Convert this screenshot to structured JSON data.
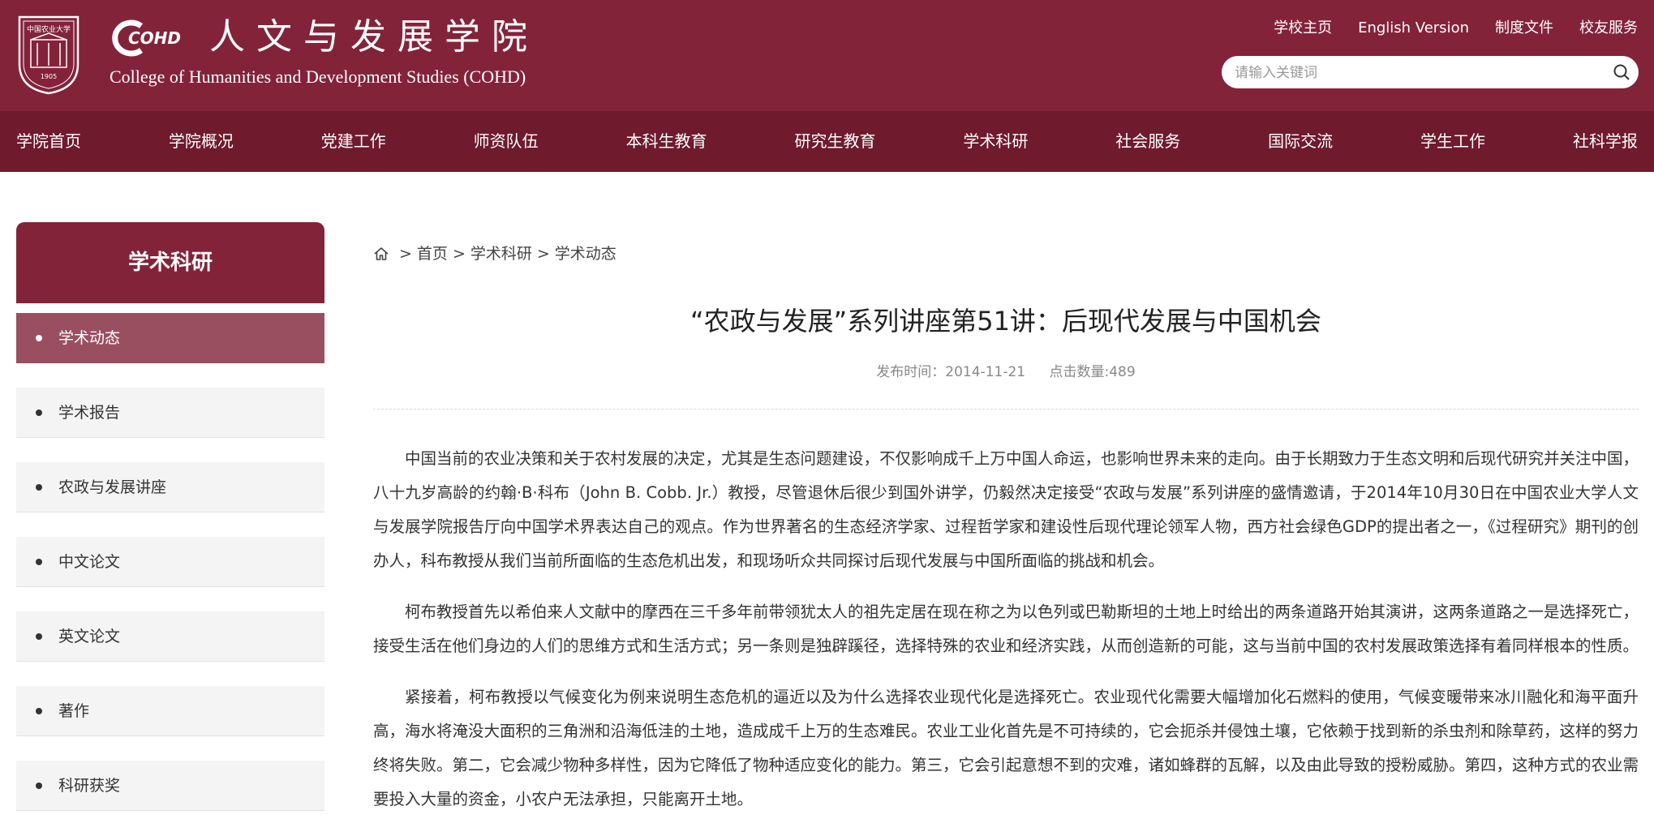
{
  "header": {
    "logo_title_cn": "人文与发展学院",
    "logo_title_en": "College of Humanities and Development Studies (COHD)",
    "logo_mark_text": "COHD",
    "seal_text": "中国农业大学",
    "seal_year": "1905",
    "top_links": [
      "学校主页",
      "English Version",
      "制度文件",
      "校友服务"
    ],
    "search_placeholder": "请输入关键词",
    "brand_color": "#83233a",
    "nav_color": "#6f1a2d"
  },
  "nav": {
    "items": [
      "学院首页",
      "学院概况",
      "党建工作",
      "师资队伍",
      "本科生教育",
      "研究生教育",
      "学术科研",
      "社会服务",
      "国际交流",
      "学生工作",
      "社科学报"
    ]
  },
  "sidebar": {
    "title": "学术科研",
    "items": [
      {
        "label": "学术动态",
        "active": true
      },
      {
        "label": "学术报告",
        "active": false
      },
      {
        "label": "农政与发展讲座",
        "active": false
      },
      {
        "label": "中文论文",
        "active": false
      },
      {
        "label": "英文论文",
        "active": false
      },
      {
        "label": "著作",
        "active": false
      },
      {
        "label": "科研获奖",
        "active": false
      }
    ]
  },
  "breadcrumb": {
    "icon": "home-icon",
    "items": [
      "首页",
      "学术科研",
      "学术动态"
    ],
    "separator": ">"
  },
  "article": {
    "title": "“农政与发展”系列讲座第51讲：后现代发展与中国机会",
    "publish_label": "发布时间：2014-11-21",
    "views_label": "点击数量:489",
    "paragraphs": [
      "中国当前的农业决策和关于农村发展的决定，尤其是生态问题建设，不仅影响成千上万中国人命运，也影响世界未来的走向。由于长期致力于生态文明和后现代研究并关注中国，八十九岁高龄的约翰·B·科布（John B. Cobb. Jr.）教授，尽管退休后很少到国外讲学，仍毅然决定接受“农政与发展”系列讲座的盛情邀请，于2014年10月30日在中国农业大学人文与发展学院报告厅向中国学术界表达自己的观点。作为世界著名的生态经济学家、过程哲学家和建设性后现代理论领军人物，西方社会绿色GDP的提出者之一，《过程研究》期刊的创办人，科布教授从我们当前所面临的生态危机出发，和现场听众共同探讨后现代发展与中国所面临的挑战和机会。",
      "柯布教授首先以希伯来人文献中的摩西在三千多年前带领犹太人的祖先定居在现在称之为以色列或巴勒斯坦的土地上时给出的两条道路开始其演讲，这两条道路之一是选择死亡，接受生活在他们身边的人们的思维方式和生活方式；另一条则是独辟蹊径，选择特殊的农业和经济实践，从而创造新的可能，这与当前中国的农村发展政策选择有着同样根本的性质。",
      "紧接着，柯布教授以气候变化为例来说明生态危机的逼近以及为什么选择农业现代化是选择死亡。农业现代化需要大幅增加化石燃料的使用，气候变暖带来冰川融化和海平面升高，海水将淹没大面积的三角洲和沿海低洼的土地，造成成千上万的生态难民。农业工业化首先是不可持续的，它会扼杀并侵蚀土壤，它依赖于找到新的杀虫剂和除草药，这样的努力终将失败。第二，它会减少物种多样性，因为它降低了物种适应变化的能力。第三，它会引起意想不到的灾难，诸如蜂群的瓦解，以及由此导致的授粉威胁。第四，这种方式的农业需要投入大量的资金，小农户无法承担，只能离开土地。"
    ]
  }
}
